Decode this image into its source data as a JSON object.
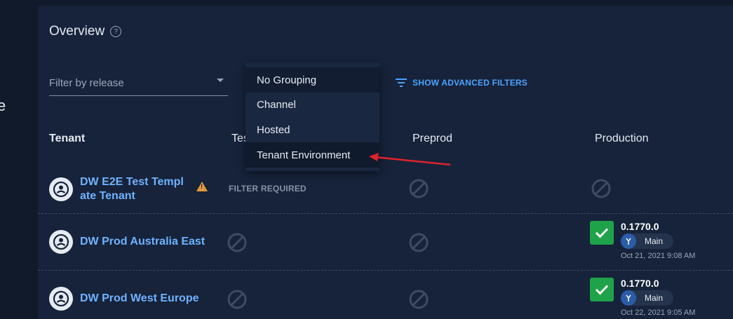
{
  "sidebar": {
    "fragment": "e"
  },
  "header": {
    "title": "Overview"
  },
  "filter": {
    "placeholder": "Filter by release"
  },
  "advanced_filters": {
    "label": "SHOW ADVANCED FILTERS"
  },
  "grouping_menu": {
    "items": [
      "No Grouping",
      "Channel",
      "Hosted",
      "Tenant Environment"
    ]
  },
  "table": {
    "columns": [
      "Tenant",
      "Test",
      "Preprod",
      "Production"
    ],
    "column_partial": "Tes",
    "rows": [
      {
        "tenant_line1": "DW E2E Test Templ",
        "tenant_line2": "ate Tenant",
        "test": "FILTER REQUIRED"
      },
      {
        "tenant": "DW Prod Australia East",
        "production": {
          "version": "0.1770.0",
          "channel": "Main",
          "date": "Oct 21, 2021 9:08 AM"
        }
      },
      {
        "tenant": "DW Prod West Europe",
        "production": {
          "version": "0.1770.0",
          "channel": "Main",
          "date": "Oct 22, 2021 9:05 AM"
        }
      }
    ]
  },
  "colors": {
    "accent": "#4da3ff",
    "success": "#1fa34a",
    "warning": "#e39a3a",
    "annotation": "#e0222a"
  }
}
